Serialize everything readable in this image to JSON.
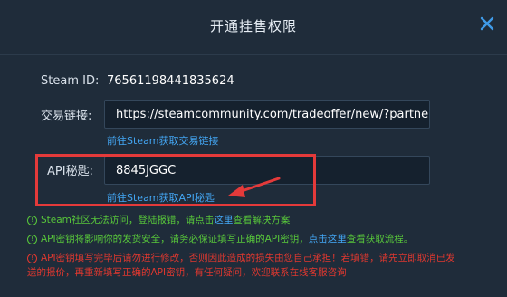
{
  "dialog": {
    "title": "开通挂售权限"
  },
  "steam_id": {
    "label": "Steam ID:",
    "value": "76561198441835624"
  },
  "trade_link": {
    "label": "交易链接:",
    "value": "https://steamcommunity.com/tradeoffer/new/?partner",
    "help_link": "前往Steam获取交易链接"
  },
  "api_key": {
    "label": "API秘匙:",
    "value": "8845JGGC",
    "help_link": "前往Steam获取API秘匙"
  },
  "notes": {
    "note1": {
      "text": "Steam社区无法访问，登陆报错，请点击",
      "link": "这里",
      "suffix": "查看解决方案"
    },
    "note2": {
      "text": "API密钥将影响你的发货安全，请务必保证填写正确的API密钥，",
      "link": "点击这里",
      "suffix": "查看获取流程。"
    },
    "note3": {
      "line1": "API密钥填写完毕后请勿进行修改，否则因此造成的损失由您自己承担！若填错，请先立即取消已发",
      "line2": "送的报价，再重新填写正确的API密钥，有任何疑问，欢迎联系在线客服咨询"
    }
  },
  "icons": {
    "close": "close-icon",
    "info": "info-circle-icon"
  },
  "colors": {
    "background": "#1f2c3a",
    "link": "#43a6f3",
    "green_note": "#58c73a",
    "red_note": "#e0382f",
    "annotation": "#e43a3a",
    "close_icon": "#3f9be8"
  }
}
